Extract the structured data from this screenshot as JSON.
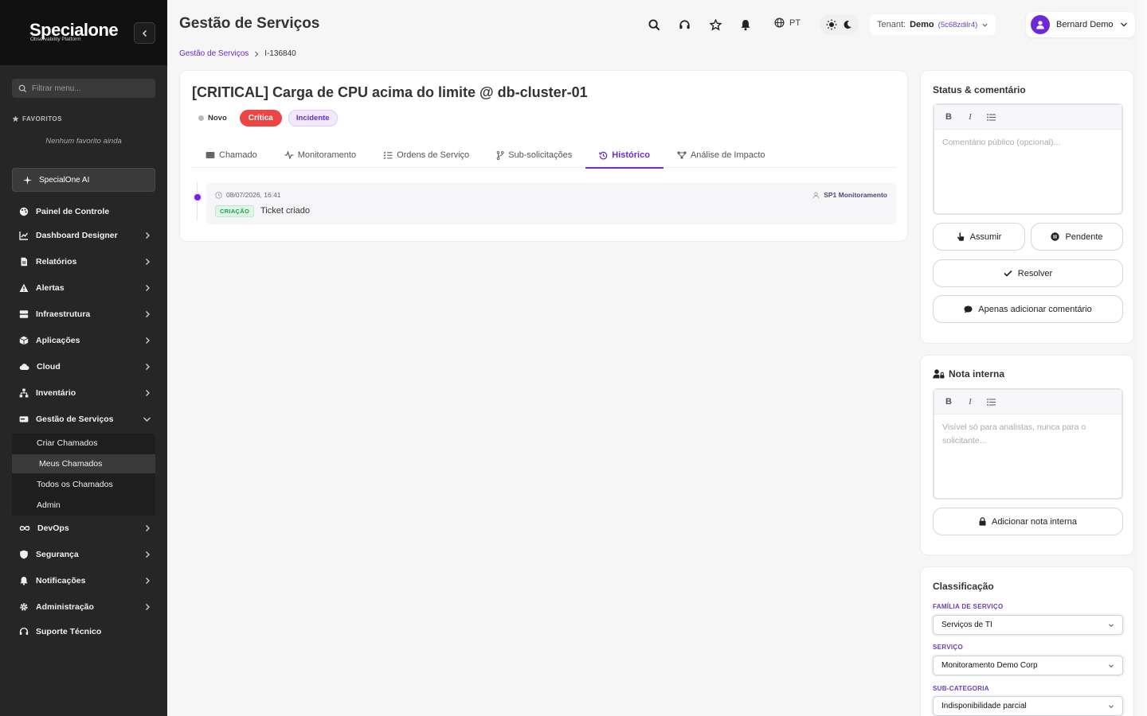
{
  "sidebar": {
    "logo_text": "Specialone",
    "logo_subtitle": "Observability Platform",
    "search_placeholder": "Filtrar menu...",
    "favorites_title": "FAVORITOS",
    "favorites_empty": "Nenhum favorito ainda",
    "ai_button": "SpecialOne AI",
    "items": [
      {
        "label": "Painel de Controle",
        "icon": "palette-icon"
      },
      {
        "label": "Dashboard Designer",
        "icon": "chart-line-icon"
      },
      {
        "label": "Relatórios",
        "icon": "file-icon"
      },
      {
        "label": "Alertas",
        "icon": "warning-icon"
      },
      {
        "label": "Infraestrutura",
        "icon": "server-icon"
      },
      {
        "label": "Aplicações",
        "icon": "box-icon"
      },
      {
        "label": "Cloud",
        "icon": "cloud-icon"
      },
      {
        "label": "Inventário",
        "icon": "sitemap-icon"
      },
      {
        "label": "Gestão de Serviços",
        "icon": "hdd-icon"
      },
      {
        "label": "DevOps",
        "icon": "infinity-icon"
      },
      {
        "label": "Segurança",
        "icon": "shield-icon"
      },
      {
        "label": "Notificações",
        "icon": "bell-icon"
      },
      {
        "label": "Administração",
        "icon": "gear-icon"
      },
      {
        "label": "Suporte Técnico",
        "icon": "headset-icon"
      }
    ],
    "submenu": [
      "Criar Chamados",
      "Meus Chamados",
      "Todos os Chamados",
      "Admin"
    ]
  },
  "header": {
    "title": "Gestão de Serviços",
    "lang": "PT",
    "tenant_label": "Tenant:",
    "tenant_name": "Demo",
    "tenant_id": "(5c68zdilr4)",
    "user_name": "Bernard Demo"
  },
  "breadcrumb": {
    "parent": "Gestão de Serviços",
    "current": "I-136840"
  },
  "ticket": {
    "title": "[CRITICAL] Carga de CPU acima do limite @ db-cluster-01",
    "status": "Novo",
    "priority": "Crítica",
    "type": "Incidente",
    "tabs": [
      "Chamado",
      "Monitoramento",
      "Ordens de Serviço",
      "Sub-solicitações",
      "Histórico",
      "Análise de Impacto"
    ],
    "active_tab": "Histórico",
    "history": [
      {
        "date": "08/07/2026, 16:41",
        "author": "SP1 Monitoramento",
        "tag": "CRIAÇÃO",
        "text": "Ticket criado"
      }
    ]
  },
  "status_panel": {
    "title": "Status & comentário",
    "editor_placeholder": "Comentário público (opcional)...",
    "btn_assume": "Assumir",
    "btn_pending": "Pendente",
    "btn_resolve": "Resolver",
    "btn_comment": "Apenas adicionar comentário"
  },
  "note_panel": {
    "title": "Nota interna",
    "editor_placeholder": "Visível só para analistas, nunca para o solicitante...",
    "btn_add": "Adicionar nota interna"
  },
  "class_panel": {
    "title": "Classificação",
    "fields": [
      {
        "label": "FAMÍLIA DE SERVIÇO",
        "value": "Serviços de TI"
      },
      {
        "label": "SERVIÇO",
        "value": "Monitoramento Demo Corp"
      },
      {
        "label": "SUB-CATEGORIA",
        "value": "Indisponibilidade parcial"
      }
    ]
  },
  "colors": {
    "accent": "#6d28d9",
    "critical": "#ef4444",
    "sidebar_bg": "#262626"
  }
}
